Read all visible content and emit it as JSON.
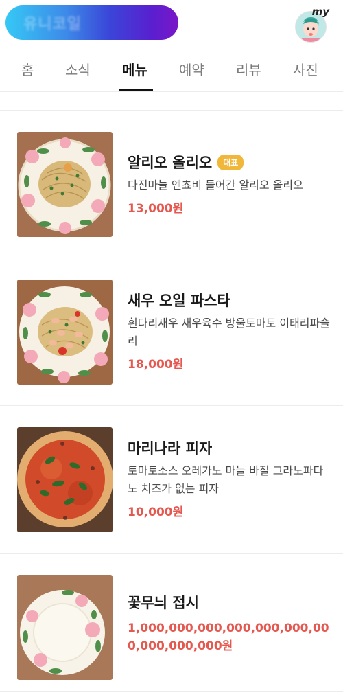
{
  "header": {
    "brand": "유니코일",
    "my_label": "my"
  },
  "tabs": [
    {
      "label": "홈"
    },
    {
      "label": "소식"
    },
    {
      "label": "메뉴",
      "active": true
    },
    {
      "label": "예약"
    },
    {
      "label": "리뷰"
    },
    {
      "label": "사진"
    }
  ],
  "menu": [
    {
      "name": "알리오 올리오",
      "badge": "대표",
      "description": "다진마늘 엔쵸비 들어간 알리오 올리오",
      "price": "13,000원"
    },
    {
      "name": "새우 오일 파스타",
      "description": "흰다리새우 새우육수 방울토마토 이태리파슬리",
      "price": "18,000원"
    },
    {
      "name": "마리나라 피자",
      "description": "토마토소스 오레가노 마늘 바질 그라노파다노 치즈가 없는 피자",
      "price": "10,000원"
    },
    {
      "name": "꽃무늬 접시",
      "price": "1,000,000,000,000,000,000,000,000,000,000원"
    }
  ],
  "colors": {
    "accent": "#e5584f",
    "badge": "#f1b73b"
  }
}
